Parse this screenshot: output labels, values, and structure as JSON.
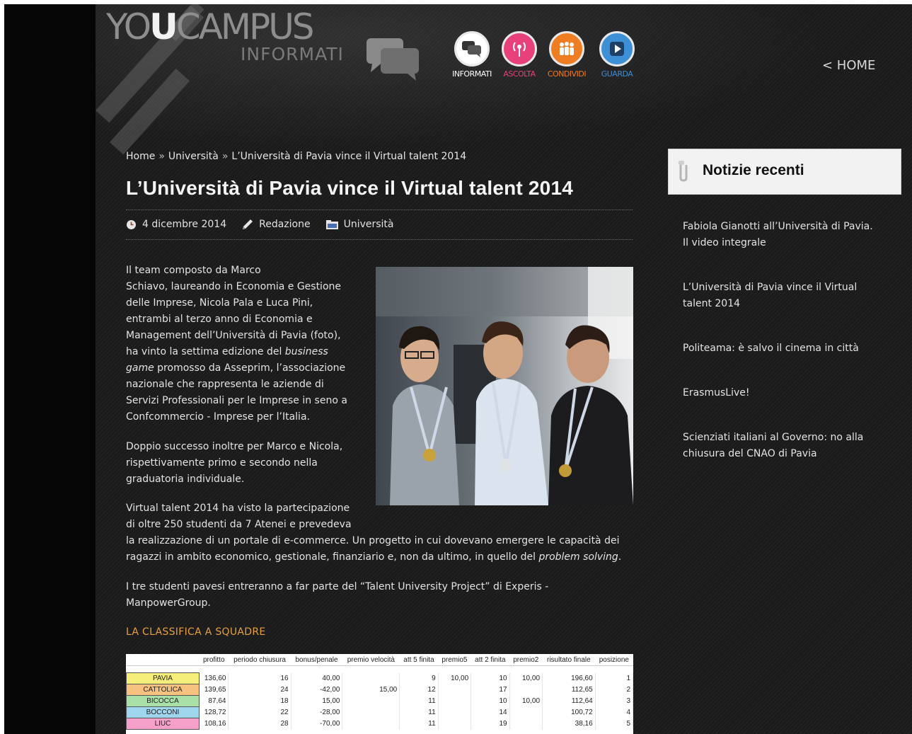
{
  "header": {
    "logo_main_a": "YO",
    "logo_main_b": "U",
    "logo_main_c": "CAMPUS",
    "logo_tagline": "INFORMATI",
    "nav": [
      {
        "label": "INFORMATI",
        "color": "#ffffff",
        "icon": "chat-bubbles-icon"
      },
      {
        "label": "ASCOLTA",
        "color": "#e8407a",
        "icon": "broadcast-icon"
      },
      {
        "label": "CONDIVIDI",
        "color": "#ef7d22",
        "icon": "people-icon"
      },
      {
        "label": "GUARDA",
        "color": "#3d8fd6",
        "icon": "play-icon"
      }
    ],
    "home_link": "< HOME"
  },
  "breadcrumb": {
    "home": "Home",
    "sep": "»",
    "category": "Università",
    "current": "L’Università di Pavia vince il Virtual talent 2014"
  },
  "article": {
    "title": "L’Università di Pavia vince il Virtual talent 2014",
    "date": "4 dicembre 2014",
    "author": "Redazione",
    "category": "Università",
    "p1_lines": [
      "Il team composto da Marco",
      "Schiavo, laureando in Economia e Gestione",
      "delle Imprese, Nicola Pala e Luca Pini,",
      "entrambi al terzo anno di Economia e",
      "Management dell’Università di Pavia (foto),"
    ],
    "p1_l6_a": "ha vinto la settima edizione del ",
    "p1_l6_em": "business",
    "p1_l7_em": "game",
    "p1_l7_b": " promosso da Asseprim, l’associazione",
    "p1_lines_end": [
      "nazionale che rappresenta le aziende di",
      "Servizi Professionali per le Imprese in seno a",
      "Confcommercio - Imprese per l’Italia."
    ],
    "p2_lines": [
      "Doppio successo inoltre per Marco e Nicola,",
      "rispettivamente primo e secondo nella",
      "graduatoria individuale."
    ],
    "p3_lines": [
      "Virtual talent 2014 ha visto la partecipazione",
      "di oltre 250 studenti da 7 Atenei e prevedeva",
      "la realizzazione di un portale di e-commerce. Un progetto in cui dovevano emergere le capacità dei"
    ],
    "p3_last_a": "ragazzi in ambito economico, gestionale, finanziario e, non da ultimo, in quello del ",
    "p3_last_em": "problem solving",
    "p3_last_b": ".",
    "p4_lines": [
      "I tre studenti pavesi entreranno a far parte del “Talent University Project” di Experis -",
      "ManpowerGroup."
    ],
    "section_title": "LA CLASSIFICA A SQUADRE"
  },
  "ranking": {
    "headers": [
      "",
      "profitto",
      "periodo chiusura",
      "bonus/penale",
      "premio velocità",
      "att 5 finita",
      "premio5",
      "att 2 finita",
      "premio2",
      "risultato finale",
      "posizione"
    ],
    "rows": [
      {
        "team": "PAVIA",
        "color": "#f6ee7a",
        "cells": [
          "136,60",
          "16",
          "40,00",
          "",
          "9",
          "10,00",
          "10",
          "10,00",
          "196,60",
          "1"
        ]
      },
      {
        "team": "CATTOLICA",
        "color": "#f7c27f",
        "cells": [
          "139,65",
          "24",
          "-42,00",
          "15,00",
          "12",
          "",
          "17",
          "",
          "112,65",
          "2"
        ]
      },
      {
        "team": "BICOCCA",
        "color": "#a8e0a8",
        "cells": [
          "87,64",
          "18",
          "15,00",
          "",
          "11",
          "",
          "10",
          "10,00",
          "112,64",
          "3"
        ]
      },
      {
        "team": "BOCCONI",
        "color": "#9fd6ee",
        "cells": [
          "128,72",
          "22",
          "-28,00",
          "",
          "11",
          "",
          "14",
          "",
          "100,72",
          "4"
        ]
      },
      {
        "team": "LIUC",
        "color": "#f4a0c8",
        "cells": [
          "108,16",
          "28",
          "-70,00",
          "",
          "11",
          "",
          "19",
          "",
          "38,16",
          "5"
        ]
      }
    ]
  },
  "sidebar": {
    "title": "Notizie recenti",
    "items": [
      [
        "Fabiola Gianotti all’Università di Pavia.",
        "Il video integrale"
      ],
      [
        "L’Università di Pavia vince il Virtual",
        "talent 2014"
      ],
      [
        "Politeama: è salvo il cinema in città"
      ],
      [
        "ErasmusLive!"
      ],
      [
        "Scienziati italiani al Governo: no alla",
        "chiusura del CNAO di Pavia"
      ]
    ]
  }
}
